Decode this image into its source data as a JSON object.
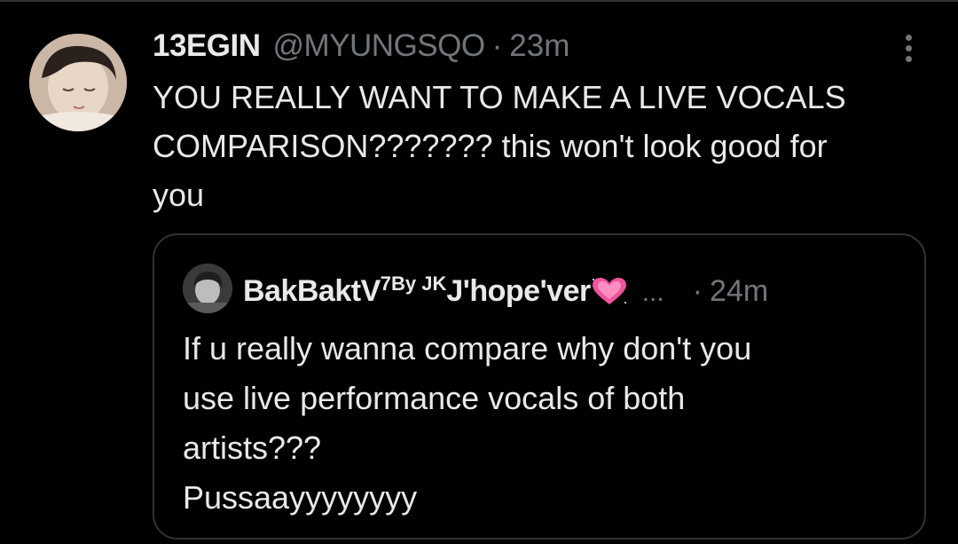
{
  "tweet": {
    "display_name": "13EGIN",
    "handle": "@MYUNGSQO",
    "separator": "·",
    "time": "23m",
    "text": "YOU REALLY WANT TO MAKE A LIVE VOCALS\nCOMPARISON??????? this won't look good for\nyou",
    "more_icon": "more-vertical-icon"
  },
  "quote": {
    "name_main": "BakBaktV",
    "name_sup1": "7",
    "name_sup2": " By JK ",
    "name_tail": "J'hope'ver",
    "name_emoji": "sparkling-heart-icon",
    "ellipsis": "...",
    "separator": "·",
    "time": "24m",
    "text": "If u really wanna compare why don't you\nuse live performance vocals of both\nartists???\nPussaayyyyyyyy"
  },
  "colors": {
    "background": "#000000",
    "text": "#e7e9ea",
    "secondary_text": "#71767b",
    "border": "#2f3336",
    "heart": "#f0549c"
  }
}
